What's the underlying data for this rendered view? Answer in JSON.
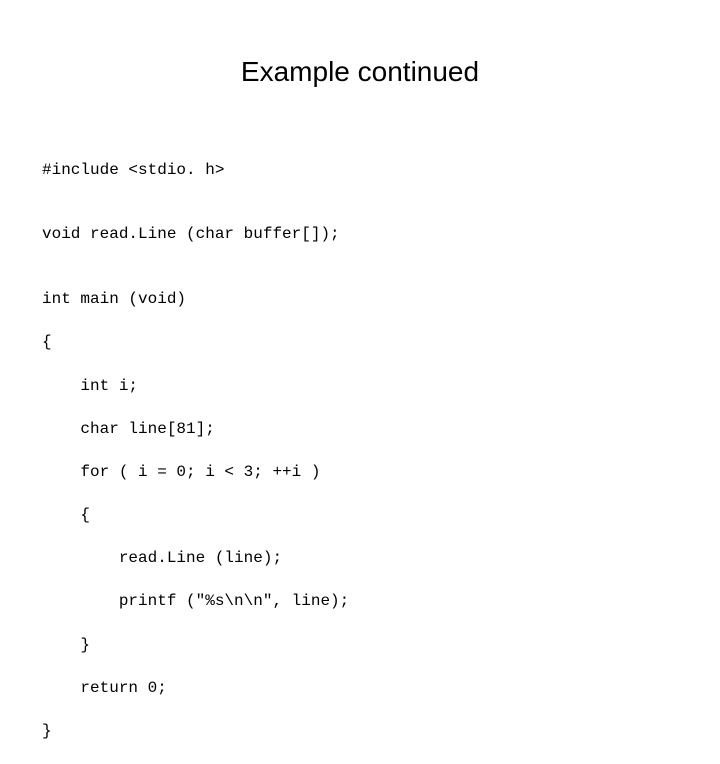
{
  "slide": {
    "title": "Example continued"
  },
  "code": {
    "lines": [
      "#include <stdio. h>",
      "",
      "void read.Line (char buffer[]);",
      "",
      "int main (void)",
      "{",
      "    int i;",
      "    char line[81];",
      "    for ( i = 0; i < 3; ++i )",
      "    {",
      "        read.Line (line);",
      "        printf (\"%s\\n\\n\", line);",
      "    }",
      "    return 0;",
      "}"
    ]
  }
}
